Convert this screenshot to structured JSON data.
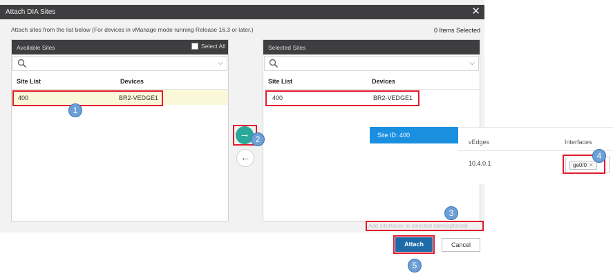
{
  "dialog": {
    "title": "Attach DIA Sites",
    "close_glyph": "✕",
    "instruction": "Attach sites from the list below (For devices in vManage mode running Release 16.3 or later.)",
    "items_selected": "0 Items Selected"
  },
  "available": {
    "title": "Available Sites",
    "select_all": "Select All",
    "search_placeholder": "",
    "columns": [
      "Site List",
      "Devices"
    ],
    "rows": [
      {
        "site": "400",
        "device": "BR2-VEDGE1"
      }
    ]
  },
  "selected": {
    "title": "Selected Sites",
    "search_placeholder": "",
    "columns": [
      "Site List",
      "Devices"
    ],
    "rows": [
      {
        "site": "400",
        "device": "BR2-VEDGE1"
      }
    ]
  },
  "site_detail": {
    "tab_label": "Site ID: 400",
    "columns": [
      "vEdges",
      "Interfaces"
    ],
    "vedge_ip": "10.4.0.1",
    "interface_tag": "ge0/0",
    "tag_remove": "✕"
  },
  "optional_link": "Add interfaces to selected sites(optional)",
  "buttons": {
    "forward": "→",
    "back": "←",
    "attach": "Attach",
    "cancel": "Cancel"
  },
  "callouts": [
    "1",
    "2",
    "3",
    "4",
    "5"
  ],
  "icons": {
    "search": "search-icon",
    "chevron": "chevron-down-icon",
    "forward": "arrow-right-icon",
    "back": "arrow-left-icon",
    "close": "close-icon"
  },
  "colors": {
    "header": "#3e3e40",
    "accent_teal": "#2aa89a",
    "tab_blue": "#1a8fe0",
    "attach_blue": "#1d6aa8",
    "highlight_red": "#e21b2d",
    "callout_blue": "#6c9fd6"
  }
}
